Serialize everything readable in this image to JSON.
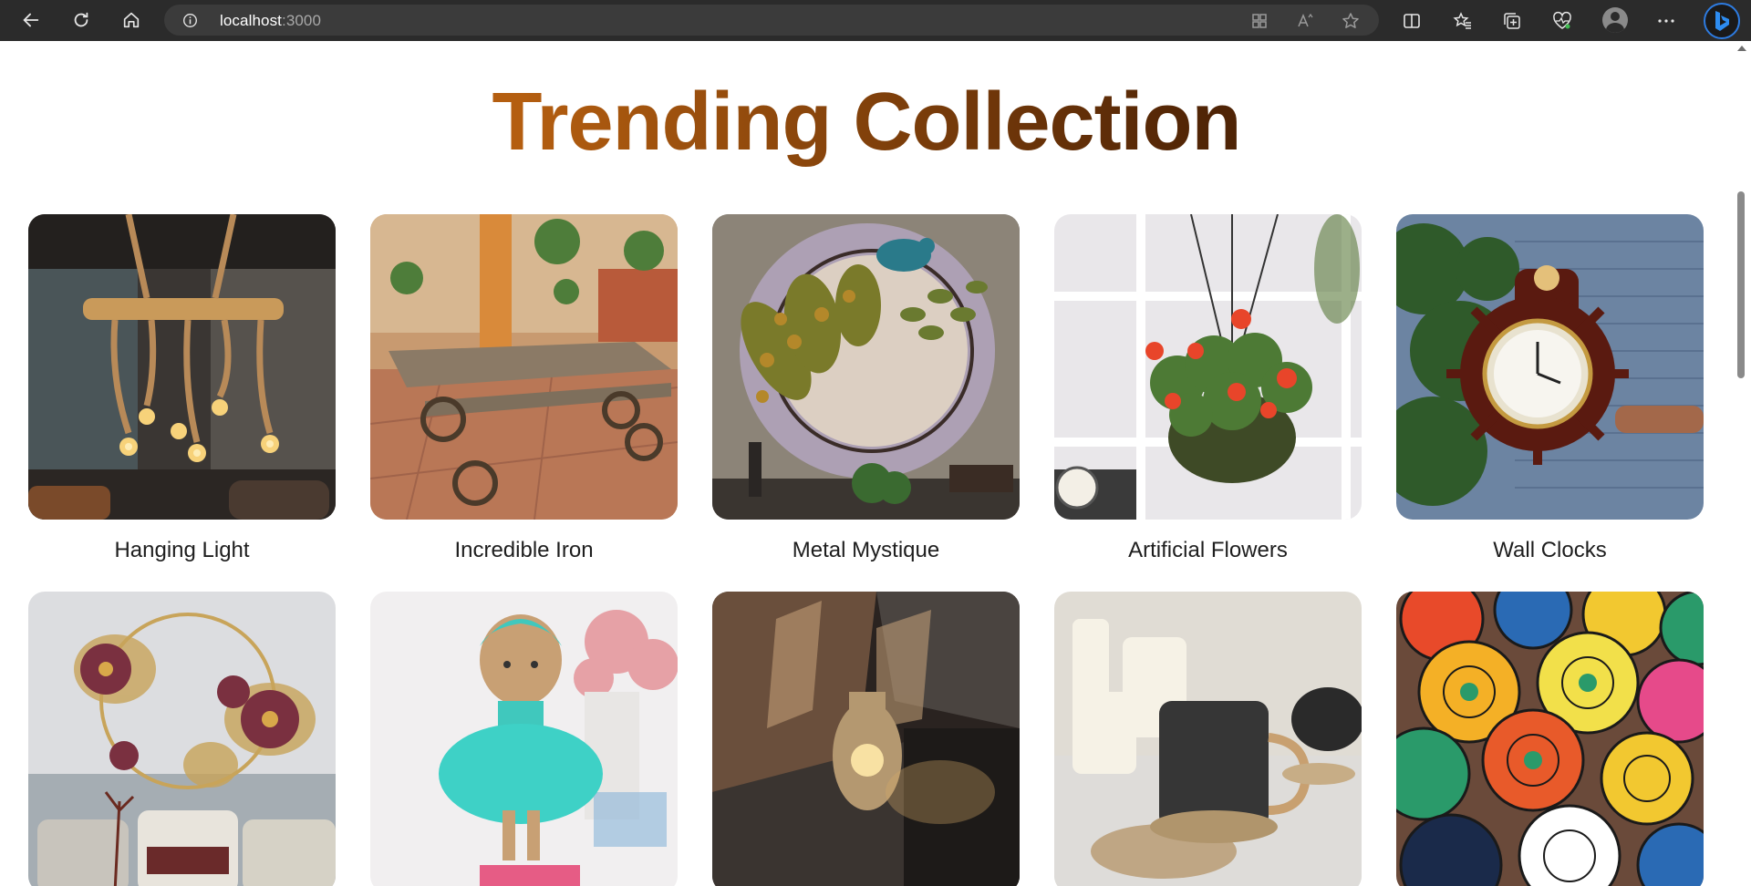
{
  "browser": {
    "url_host": "localhost",
    "url_port": ":3000"
  },
  "page": {
    "title": "Trending Collection",
    "title_colors": [
      "#b45e10",
      "#4f2406"
    ]
  },
  "products": [
    {
      "label": "Hanging Light",
      "icon": "hanging-light-image"
    },
    {
      "label": "Incredible Iron",
      "icon": "iron-bench-image"
    },
    {
      "label": "Metal Mystique",
      "icon": "metal-peacock-image"
    },
    {
      "label": "Artificial Flowers",
      "icon": "hanging-flowers-image"
    },
    {
      "label": "Wall Clocks",
      "icon": "wall-clock-image"
    },
    {
      "label": "",
      "icon": "metal-flower-wall-art-image"
    },
    {
      "label": "",
      "icon": "crochet-doll-image"
    },
    {
      "label": "",
      "icon": "lamp-vase-image"
    },
    {
      "label": "",
      "icon": "ceramic-mug-image"
    },
    {
      "label": "",
      "icon": "painted-bowls-image"
    }
  ]
}
